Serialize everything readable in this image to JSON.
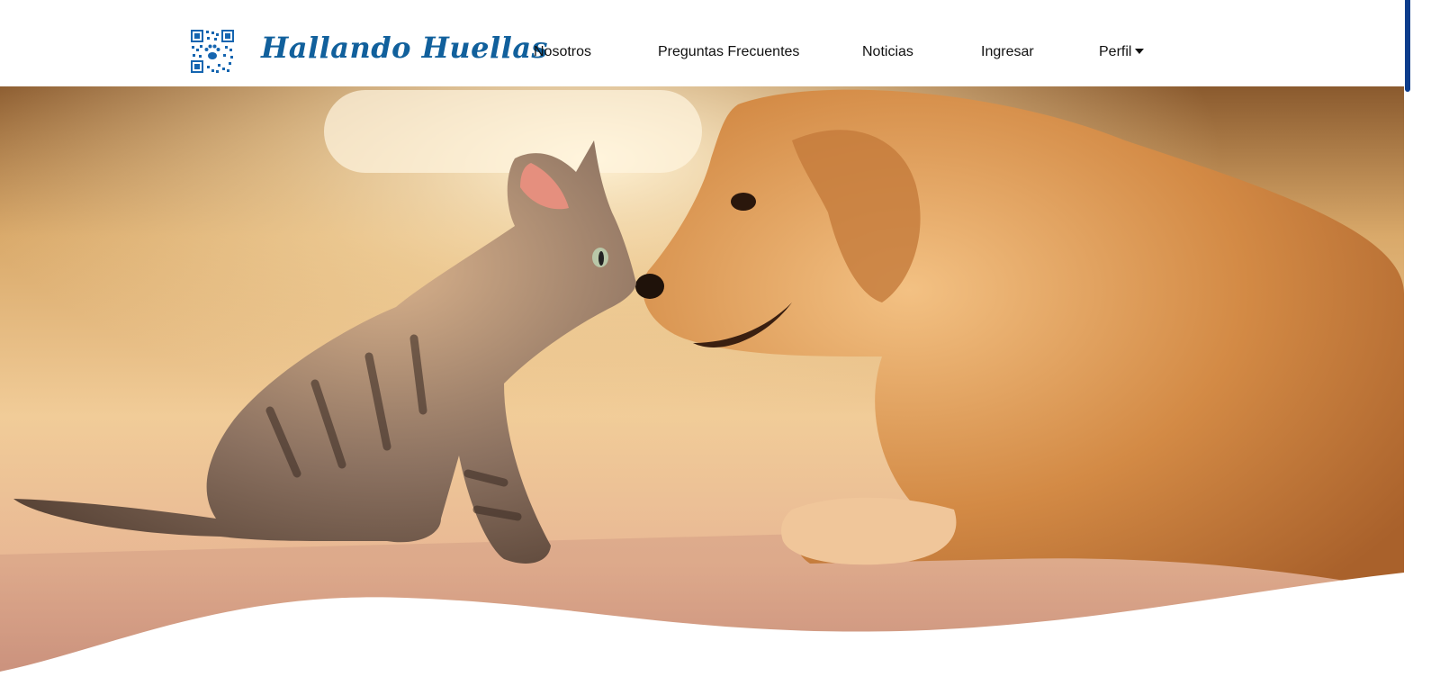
{
  "brand": {
    "name": "Hallando Huellas",
    "logo_icon": "qr-code-paw-icon",
    "color": "#11609c"
  },
  "nav": {
    "items": [
      {
        "label": "Nosotros"
      },
      {
        "label": "Preguntas Frecuentes"
      },
      {
        "label": "Noticias"
      },
      {
        "label": "Ingresar"
      }
    ],
    "profile": {
      "label": "Perfil",
      "icon": "caret-down-icon"
    }
  },
  "hero": {
    "image": "kitten-and-golden-retriever-touching-noses",
    "tones": {
      "warm_light": "#f7d9a8",
      "dog_fur": "#d8954e",
      "kitten_fur": "#8b7160",
      "floor": "#c99883"
    }
  },
  "scrollbar": {
    "thumb_color": "#0d3d8c"
  }
}
